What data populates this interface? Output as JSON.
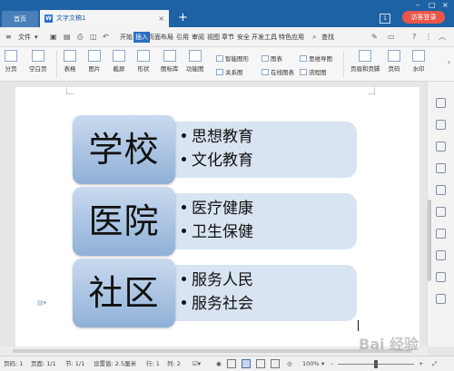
{
  "titlebar": {
    "home_tab": "首页",
    "doc_tab": "文字文稿1",
    "doc_tab_icon": "W",
    "close_glyph": "×",
    "new_tab_glyph": "+",
    "badge": "1",
    "guest_button": "访客登录",
    "minimize_glyph": "–",
    "maximize_glyph": "□",
    "close_window_glyph": "×"
  },
  "menubar": {
    "hamburger_glyph": "≡",
    "file_label": "文件",
    "file_arrow": "▾",
    "items": [
      "开始",
      "插入",
      "页面布局",
      "引用",
      "审阅",
      "视图",
      "章节",
      "安全",
      "开发工具",
      "特色应用"
    ],
    "active_item": "插入",
    "search_label": "查找",
    "help_glyph": "?",
    "more_glyph": "⋮",
    "collapse_glyph": "︿"
  },
  "ribbon": {
    "buttons": [
      "分页",
      "空白页",
      "表格",
      "图片",
      "截屏",
      "形状",
      "图标库",
      "功能图",
      "页眉和页脚",
      "页码",
      "水印"
    ],
    "small_buttons": [
      "智能图形",
      "关系图",
      "图表",
      "在线图表",
      "思维导图",
      "流程图"
    ],
    "chevron": "›"
  },
  "smartart": {
    "colors": {
      "header_top": "#c9daee",
      "header_bottom": "#8fb0d8",
      "panel": "#d8e4f1"
    },
    "groups": [
      {
        "title": "学校",
        "items": [
          "思想教育",
          "文化教育"
        ]
      },
      {
        "title": "医院",
        "items": [
          "医疗健康",
          "卫生保健"
        ]
      },
      {
        "title": "社区",
        "items": [
          "服务人民",
          "服务社会"
        ]
      }
    ]
  },
  "statusbar": {
    "page_num": "页码: 1",
    "page_of": "页面: 1/1",
    "section": "节: 1/1",
    "setting": "设置值: 2.5厘米",
    "row": "行: 1",
    "col": "列: 2",
    "zoom": "100%",
    "zoom_minus": "–",
    "zoom_plus": "+",
    "zoom_level": 0.5
  },
  "watermark": "Bai 经验"
}
